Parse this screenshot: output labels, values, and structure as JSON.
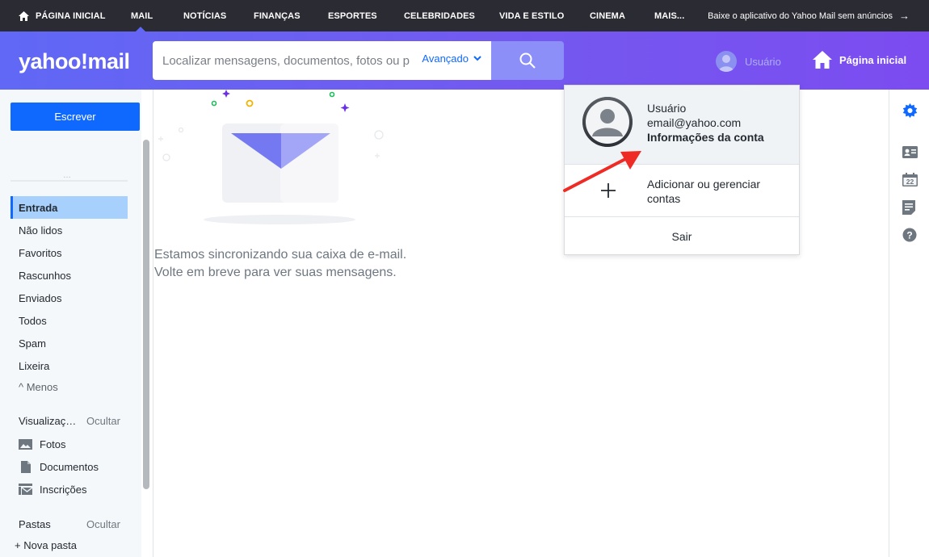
{
  "topnav": {
    "items": [
      {
        "label": "PÁGINA INICIAL"
      },
      {
        "label": "MAIL"
      },
      {
        "label": "NOTÍCIAS"
      },
      {
        "label": "FINANÇAS"
      },
      {
        "label": "ESPORTES"
      },
      {
        "label": "CELEBRIDADES"
      },
      {
        "label": "VIDA E ESTILO"
      },
      {
        "label": "CINEMA"
      },
      {
        "label": "MAIS..."
      }
    ],
    "promo": "Baixe o aplicativo do Yahoo Mail sem anúncios",
    "promo_arrow": "→"
  },
  "header": {
    "logo": "yahoo!mail",
    "search_placeholder": "Localizar mensagens, documentos, fotos ou p",
    "advanced_label": "Avançado",
    "user_label": "Usuário",
    "home_label": "Página inicial",
    "accent": "#0f69ff"
  },
  "sidebar": {
    "compose_label": "Escrever",
    "handle": "…",
    "folders": [
      {
        "label": "Entrada",
        "active": true
      },
      {
        "label": "Não lidos"
      },
      {
        "label": "Favoritos"
      },
      {
        "label": "Rascunhos"
      },
      {
        "label": "Enviados"
      },
      {
        "label": "Todos"
      },
      {
        "label": "Spam"
      },
      {
        "label": "Lixeira"
      }
    ],
    "less_label": "^ Menos",
    "views_heading": "Visualizaç…",
    "views_hide": "Ocultar",
    "views": [
      {
        "label": "Fotos",
        "icon": "photo-icon"
      },
      {
        "label": "Documentos",
        "icon": "document-icon"
      },
      {
        "label": "Inscrições",
        "icon": "subscriptions-icon"
      }
    ],
    "folders_heading": "Pastas",
    "folders_hide": "Ocultar",
    "new_folder": "+ Nova pasta"
  },
  "main": {
    "empty_line1": "Estamos sincronizando sua caixa de e-mail.",
    "empty_line2": "Volte em breve para ver suas mensagens."
  },
  "rail": {
    "icons": [
      "settings-icon",
      "contacts-icon",
      "calendar-icon",
      "notepad-icon",
      "help-icon"
    ],
    "calendar_day": "22"
  },
  "account_menu": {
    "name": "Usuário",
    "email": "email@yahoo.com",
    "account_info": "Informações da conta",
    "add_accounts": "Adicionar ou gerenciar contas",
    "sign_out": "Sair"
  }
}
